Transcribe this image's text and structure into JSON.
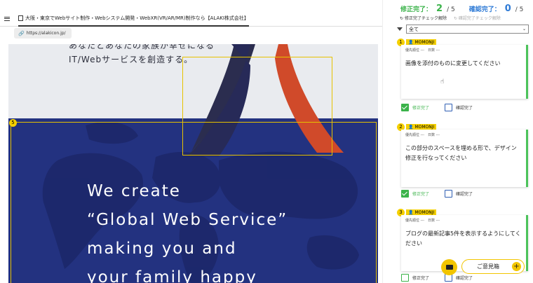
{
  "window": {
    "tab_title": "大阪・東京でWebサイト制作・Webシステム開発・WebXR(VR/AR/MR)制作なら【ALAKI株式会社】",
    "url": "https://alakicon.jp/"
  },
  "hero": {
    "intro_lines": [
      "あなたとあなたの家族が幸せになる",
      "IT/Webサービスを創造する。"
    ],
    "tagline_lines": [
      "We create",
      "“Global Web Service”",
      "making you and",
      "your family happy"
    ],
    "pin_label": "5"
  },
  "panel": {
    "fix_done_label": "修正完了：",
    "fix_done_count": "2",
    "fix_done_total": "/ 5",
    "confirm_done_label": "確認完了：",
    "confirm_done_count": "0",
    "confirm_done_total": "/ 5",
    "filter_link_fix": "修正完了チェック解除",
    "filter_link_confirm": "確認完了チェック解除",
    "filter_value": "全て",
    "comments": [
      {
        "num": "1",
        "user": "MOMONJI",
        "meta": "優先順位 ---　日数 ---",
        "text": "画像を添付のものに変更してください",
        "fix_label": "修正完了",
        "confirm_label": "確認完了"
      },
      {
        "num": "2",
        "user": "MOMONJI",
        "meta": "優先順位 ---　日数 ---",
        "text": "この部分のスペースを埋める形で、デザイン修正を行なってください",
        "fix_label": "修正完了",
        "confirm_label": "確認完了"
      },
      {
        "num": "3",
        "user": "MOMONJI",
        "meta": "優先順位 ---　日数 ---",
        "text": "ブログの最新記事5件を表示するようにしてください",
        "fix_label": "修正完了",
        "confirm_label": "確認完了"
      }
    ],
    "opinion_button": "ご意見箱"
  },
  "colors": {
    "accent_yellow": "#f5d000",
    "done_green": "#3bb34a",
    "confirm_blue": "#2f7bd6",
    "hero_navy": "#233280",
    "logo_red": "#d04a2a"
  },
  "icons": [
    "menu-icon",
    "page-icon",
    "link-icon",
    "funnel-icon",
    "person-icon",
    "checkbox-icon",
    "mail-icon",
    "plus-icon",
    "cursor-icon"
  ]
}
